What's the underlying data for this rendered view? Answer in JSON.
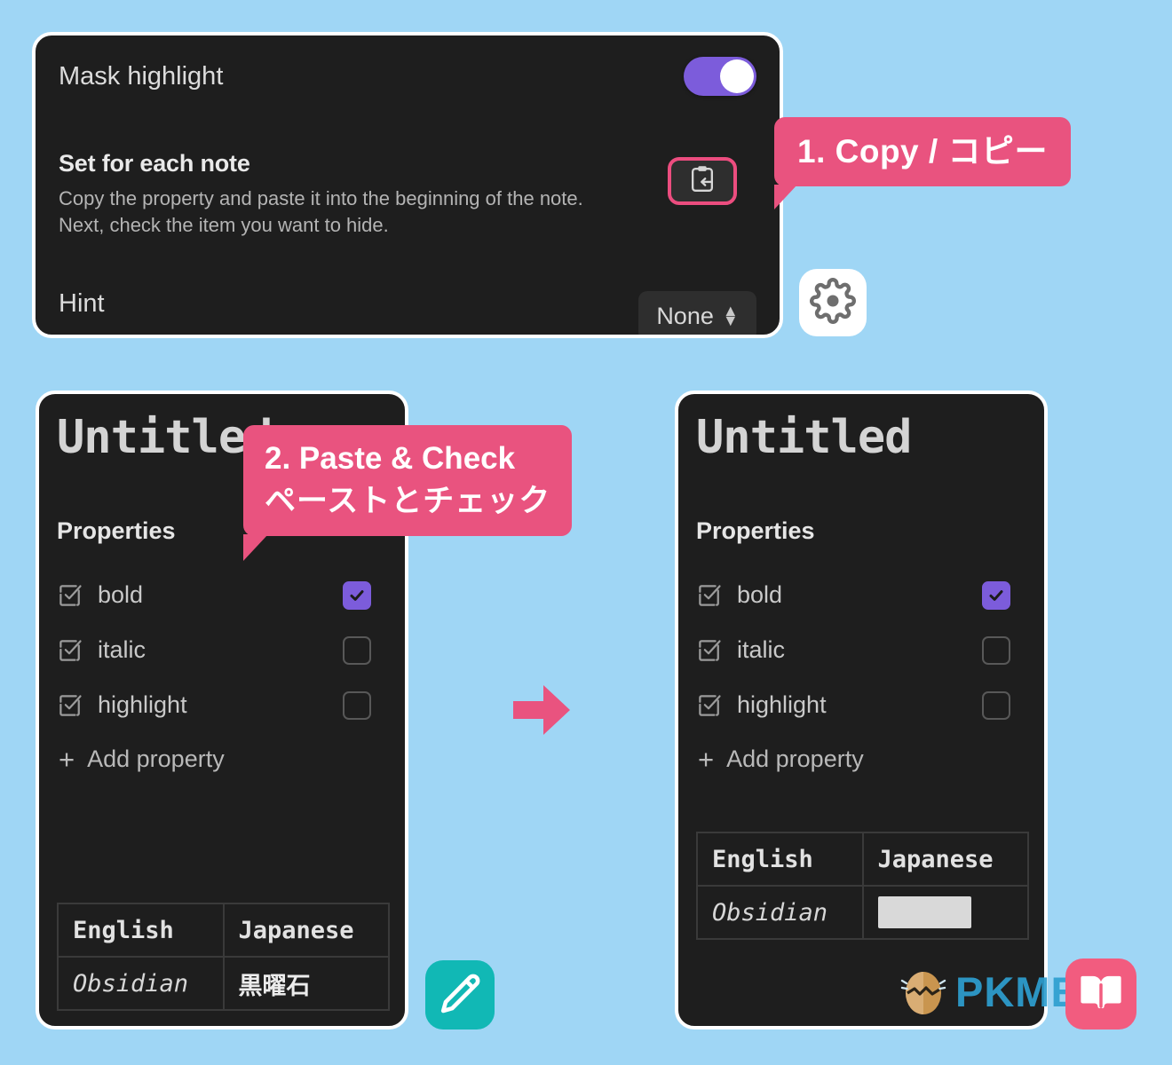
{
  "background_color": "#9fd6f5",
  "accent_colors": {
    "callout_pink": "#e9537f",
    "toggle_purple": "#7c5cdb",
    "checkbox_purple": "#7c5cdb",
    "arrow_pink": "#e9537f",
    "card_dark": "#1e1e1e",
    "pencil_teal": "#11b8b5",
    "book_pink": "#f25c7f",
    "watermark_blue": "#2e9fd0"
  },
  "settings_panel": {
    "mask_highlight": {
      "label": "Mask highlight",
      "toggle_state": "on"
    },
    "set_for_each_note": {
      "title": "Set for each note",
      "description_line_1": "Copy the property and paste it into the beginning of the note.",
      "description_line_2": "Next, check the item you want to hide.",
      "copy_button_icon": "clipboard-paste-icon"
    },
    "hint": {
      "label": "Hint",
      "selected_value": "None"
    }
  },
  "callouts": [
    {
      "id": "copy",
      "text": "1. Copy / コピー"
    },
    {
      "id": "paste",
      "line_en": "2. Paste & Check",
      "line_jp": "ペーストとチェック"
    }
  ],
  "note_left": {
    "title": "Untitled",
    "properties_heading": "Properties",
    "properties": [
      {
        "name": "bold",
        "checked": true
      },
      {
        "name": "italic",
        "checked": false
      },
      {
        "name": "highlight",
        "checked": false
      }
    ],
    "add_property_label": "Add property",
    "table": {
      "headers": [
        "English",
        "Japanese"
      ],
      "rows": [
        {
          "english": "Obsidian",
          "japanese": "黒曜石",
          "japanese_masked": false
        }
      ]
    }
  },
  "note_right": {
    "title": "Untitled",
    "properties_heading": "Properties",
    "properties": [
      {
        "name": "bold",
        "checked": true
      },
      {
        "name": "italic",
        "checked": false
      },
      {
        "name": "highlight",
        "checked": false
      }
    ],
    "add_property_label": "Add property",
    "table": {
      "headers": [
        "English",
        "Japanese"
      ],
      "rows": [
        {
          "english": "Obsidian",
          "japanese": "",
          "japanese_masked": true
        }
      ]
    }
  },
  "floating_icons": [
    {
      "id": "gear",
      "icon": "gear-icon"
    },
    {
      "id": "pencil",
      "icon": "pencil-icon"
    },
    {
      "id": "book",
      "icon": "open-book-icon"
    }
  ],
  "flow_arrow_icon": "arrow-right-icon",
  "watermark": {
    "text": "PKMER",
    "logo_icon": "egg-logo-icon"
  }
}
